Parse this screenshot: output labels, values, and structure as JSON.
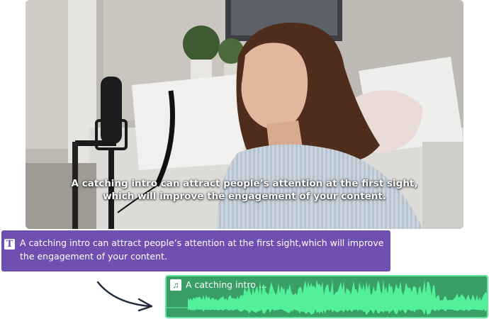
{
  "video": {
    "subtitle_line1": "A catching intro can attract people’s attention at the first sight,",
    "subtitle_line2": "which will improve the engagement of your content."
  },
  "text_clip": {
    "icon": "text-T-icon",
    "icon_glyph": "T",
    "line1": "A catching intro can attract people’s attention at the first sight,which will improve",
    "line2": "the engagement of your content.",
    "color": "#6f4fb0"
  },
  "audio_clip": {
    "icon": "music-note-icon",
    "icon_glyph": "♫",
    "label": "A catching intro ...",
    "color": "#3a9e67",
    "wave_color": "#52f09a"
  }
}
